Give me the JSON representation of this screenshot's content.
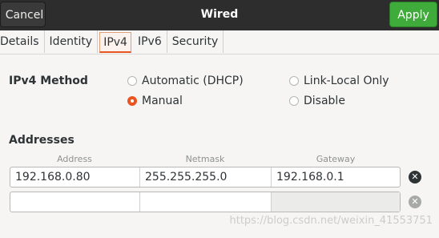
{
  "header": {
    "cancel_label": "Cancel",
    "title": "Wired",
    "apply_label": "Apply"
  },
  "tabs": [
    {
      "label": "Details"
    },
    {
      "label": "Identity"
    },
    {
      "label": "IPv4",
      "active": true
    },
    {
      "label": "IPv6"
    },
    {
      "label": "Security"
    }
  ],
  "ipv4_method": {
    "label": "IPv4 Method",
    "options": [
      {
        "label": "Automatic (DHCP)",
        "selected": false
      },
      {
        "label": "Link-Local Only",
        "selected": false
      },
      {
        "label": "Manual",
        "selected": true
      },
      {
        "label": "Disable",
        "selected": false
      }
    ]
  },
  "addresses": {
    "label": "Addresses",
    "columns": [
      "Address",
      "Netmask",
      "Gateway"
    ],
    "rows": [
      [
        "192.168.0.80",
        "255.255.255.0",
        "192.168.0.1"
      ],
      [
        "",
        "",
        ""
      ]
    ]
  },
  "watermark": "https://blog.csdn.net/weixin_41553751",
  "colors": {
    "accent": "#e95420",
    "apply": "#3fab3a",
    "headerbar": "#2d2d2d"
  },
  "icons": {
    "delete_row": "x-circle-icon"
  }
}
